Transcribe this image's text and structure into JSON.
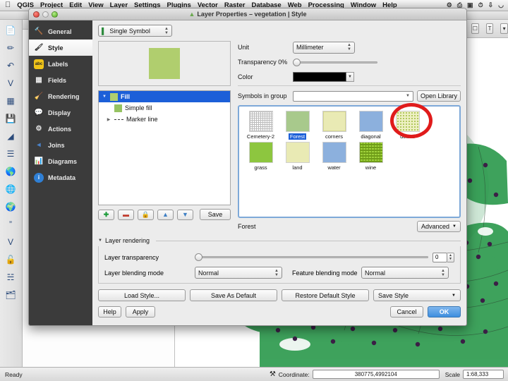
{
  "menubar": {
    "apple": "apple-logo",
    "items": [
      "QGIS",
      "Project",
      "Edit",
      "View",
      "Layer",
      "Settings",
      "Plugins",
      "Vector",
      "Raster",
      "Database",
      "Web",
      "Processing",
      "Window",
      "Help"
    ],
    "tray": [
      "dropbox-icon",
      "screen-share-icon",
      "display-icon",
      "timemachine-icon",
      "bluetooth-icon",
      "wifi-icon"
    ]
  },
  "dialog": {
    "title": "Layer Properties – vegetation | Style",
    "title_icon": "qgis-layer-icon",
    "window_controls": [
      "close-button",
      "minimize-button",
      "zoom-button"
    ],
    "sidebar": {
      "items": [
        {
          "label": "General",
          "icon": "tools-icon"
        },
        {
          "label": "Style",
          "icon": "brush-icon"
        },
        {
          "label": "Labels",
          "icon": "abc-icon"
        },
        {
          "label": "Fields",
          "icon": "table-icon"
        },
        {
          "label": "Rendering",
          "icon": "broom-icon"
        },
        {
          "label": "Display",
          "icon": "speech-bubble-icon"
        },
        {
          "label": "Actions",
          "icon": "gear-icon"
        },
        {
          "label": "Joins",
          "icon": "join-icon"
        },
        {
          "label": "Diagrams",
          "icon": "chart-icon"
        },
        {
          "label": "Metadata",
          "icon": "info-icon"
        }
      ],
      "active": "Style"
    },
    "renderer": {
      "label": "Single Symbol",
      "icon": "single-symbol-icon"
    },
    "preview": {
      "color": "#b0ce6e"
    },
    "symbol_layers": [
      {
        "label": "Fill",
        "type": "swatch",
        "color": "#b0ce6e",
        "selected": true,
        "twisty": "down"
      },
      {
        "label": "Simple fill",
        "type": "swatch",
        "color": "#96c362",
        "selected": false,
        "twisty": "none",
        "indent": 1
      },
      {
        "label": "Marker line",
        "type": "dash",
        "selected": false,
        "twisty": "right",
        "indent": 0
      }
    ],
    "layer_toolbar": {
      "add": "add-symbol-layer-icon",
      "remove": "remove-symbol-layer-icon",
      "lock": "lock-icon",
      "up": "move-up-icon",
      "down": "move-down-icon",
      "save_label": "Save"
    },
    "properties": {
      "unit_label": "Unit",
      "unit_value": "Millimeter",
      "transparency_label": "Transparency 0%",
      "transparency_value": 0,
      "color_label": "Color",
      "color_value": "#000000",
      "symbols_group_label": "Symbols in group",
      "symbols_group_value": "",
      "open_library_label": "Open Library"
    },
    "symbol_library": {
      "items": [
        {
          "name": "Cemetery-2",
          "style": "grid",
          "color": "#f2f2f2",
          "selected": false
        },
        {
          "name": "Forest",
          "style": "solid",
          "color": "#a8c98c",
          "selected": true
        },
        {
          "name": "corners",
          "style": "corners",
          "color": "#e9eab4",
          "selected": false
        },
        {
          "name": "diagonal",
          "style": "solid",
          "color": "#8cb0dd",
          "selected": false
        },
        {
          "name": "dotted",
          "style": "dotted",
          "color": "#eef0c3",
          "selected": false
        },
        {
          "name": "grass",
          "style": "solid",
          "color": "#8dc63f",
          "selected": false,
          "annotated": true
        },
        {
          "name": "land",
          "style": "solid",
          "color": "#e9eab4",
          "selected": false
        },
        {
          "name": "water",
          "style": "solid",
          "color": "#8cb0dd",
          "selected": false
        },
        {
          "name": "wine",
          "style": "hatch",
          "color": "#9ed13b",
          "selected": false
        }
      ],
      "current_symbol": "Forest",
      "advanced_label": "Advanced"
    },
    "layer_rendering": {
      "section_label": "Layer rendering",
      "transparency_label": "Layer transparency",
      "transparency_value": "0",
      "layer_blend_label": "Layer blending mode",
      "layer_blend_value": "Normal",
      "feature_blend_label": "Feature blending mode",
      "feature_blend_value": "Normal"
    },
    "buttons": {
      "load_style": "Load Style...",
      "save_as_default": "Save As Default",
      "restore_default": "Restore Default Style",
      "save_style": "Save Style",
      "help": "Help",
      "apply": "Apply",
      "cancel": "Cancel",
      "ok": "OK"
    }
  },
  "statusbar": {
    "ready": "Ready",
    "render_icon": "render-icon",
    "coordinate_label": "Coordinate:",
    "coordinate_value": "380775,4992104",
    "scale_label": "Scale",
    "scale_value": "1:68,333"
  },
  "colors": {
    "selection_blue": "#1c5fd8",
    "annotation_red": "#e01b1b",
    "sidebar_dark": "#3b3b3b",
    "ok_blue": "#3d8ede",
    "map_green": "#2e9b4f",
    "map_point": "#3b1f46"
  }
}
